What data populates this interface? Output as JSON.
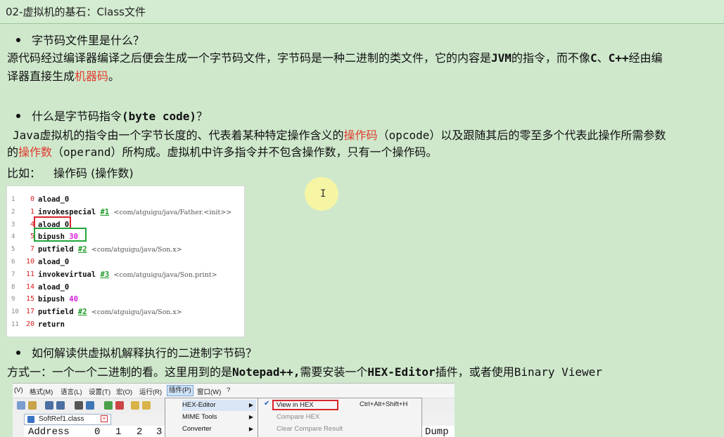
{
  "title": "02-虚拟机的基石：Class文件",
  "sections": {
    "q1": {
      "bullet": "字节码文件里是什么？",
      "answer_line1_a": "源代码经过编译器编译之后便会生成一个字节码文件，字节码是一种二进制的类文件，它的内容是",
      "answer_line1_jvm": "JVM",
      "answer_line1_b": "的指令，而不像",
      "answer_line1_c": "C",
      "answer_line1_d": "、",
      "answer_line1_cpp": "C++",
      "answer_line1_e": "经由编",
      "answer_line2_a": "译器直接生成",
      "answer_line2_red": "机器码",
      "answer_line2_b": "。"
    },
    "q2": {
      "bullet_a": "什么是字节码指令",
      "bullet_mono": "(byte code)",
      "bullet_b": "？",
      "l1_java": "Java",
      "l1_a": "虚拟机的指令由一个字节长度的、代表着某种特定操作含义的",
      "l1_red": "操作码",
      "l1_b": "（",
      "l1_opcode": "opcode",
      "l1_c": "）以及跟随其后的零至多个代表此操作所需参数",
      "l2_a": "的",
      "l2_red": "操作数",
      "l2_b": "（",
      "l2_operand": "operand",
      "l2_c": "）所构成。虚拟机中许多指令并不包含操作数，只有一个操作码。",
      "example_label": "比如：",
      "example_value": "操作码 (操作数)"
    },
    "q3": {
      "bullet": "如何解读供虚拟机解释执行的二进制字节码？",
      "way_a": "方式一：一个一个二进制的看。这里用到的是",
      "way_npp": "Notepad++,",
      "way_b": "需要安装一个",
      "way_hex": "HEX-Editor",
      "way_c": "插件，或者使用",
      "way_bv": "Binary Viewer"
    }
  },
  "bytecode": [
    {
      "ln": "1",
      "off": "0",
      "op": "aload_0",
      "ref": "",
      "cmt": "",
      "num": ""
    },
    {
      "ln": "2",
      "off": "1",
      "op": "invokespecial",
      "ref": "#1",
      "cmt": "<com/atguigu/java/Father.<init>>",
      "num": ""
    },
    {
      "ln": "3",
      "off": "4",
      "op": "aload_0",
      "ref": "",
      "cmt": "",
      "num": ""
    },
    {
      "ln": "4",
      "off": "5",
      "op": "bipush",
      "ref": "",
      "cmt": "",
      "num": "30"
    },
    {
      "ln": "5",
      "off": "7",
      "op": "putfield",
      "ref": "#2",
      "cmt": "<com/atguigu/java/Son.x>",
      "num": ""
    },
    {
      "ln": "6",
      "off": "10",
      "op": "aload_0",
      "ref": "",
      "cmt": "",
      "num": ""
    },
    {
      "ln": "7",
      "off": "11",
      "op": "invokevirtual",
      "ref": "#3",
      "cmt": "<com/atguigu/java/Son.print>",
      "num": ""
    },
    {
      "ln": "8",
      "off": "14",
      "op": "aload_0",
      "ref": "",
      "cmt": "",
      "num": ""
    },
    {
      "ln": "9",
      "off": "15",
      "op": "bipush",
      "ref": "",
      "cmt": "",
      "num": "40"
    },
    {
      "ln": "10",
      "off": "17",
      "op": "putfield",
      "ref": "#2",
      "cmt": "<com/atguigu/java/Son.x>",
      "num": ""
    },
    {
      "ln": "11",
      "off": "20",
      "op": "return",
      "ref": "",
      "cmt": "",
      "num": ""
    }
  ],
  "notepad": {
    "menus": [
      "(V)",
      "格式(M)",
      "语言(L)",
      "设置(T)",
      "宏(O)",
      "运行(R)",
      "插件(P)",
      "窗口(W)",
      "?"
    ],
    "tab_label": "SoftRef1.class",
    "hex_header": [
      "Address",
      "0",
      "1",
      "2",
      "3",
      "Dump"
    ],
    "plugin_menu": [
      "HEX-Editor",
      "MIME Tools",
      "Converter"
    ],
    "hex_submenu": {
      "view": "View in HEX",
      "view_shortcut": "Ctrl+Alt+Shift+H",
      "compare": "Compare HEX",
      "clear": "Clear Compare Result"
    }
  },
  "colors": {
    "background": "#cfe8cc",
    "highlight_red": "#e03b2e",
    "box_red": "#d9242c",
    "box_green": "#1fa53a"
  }
}
